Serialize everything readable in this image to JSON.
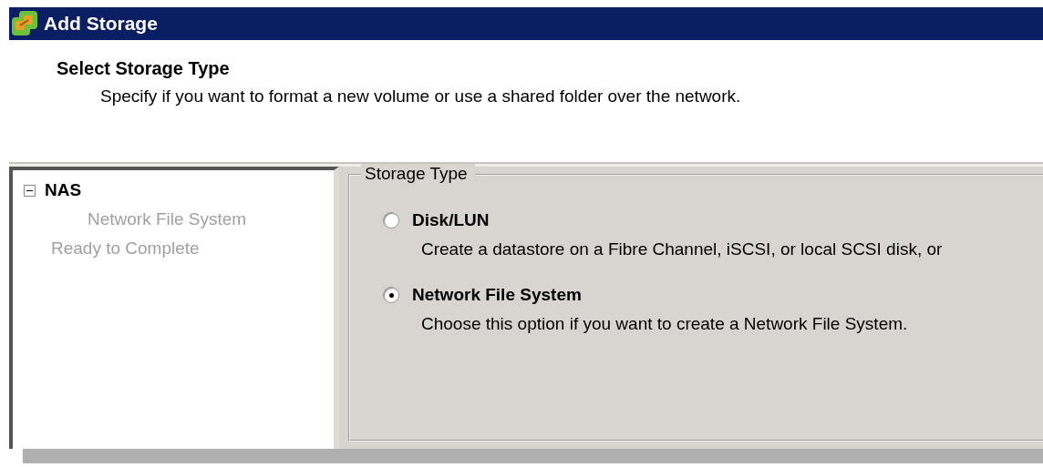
{
  "window": {
    "title": "Add Storage"
  },
  "header": {
    "title": "Select Storage Type",
    "subtitle": "Specify if you want to format a new volume or use a shared folder over the network."
  },
  "steps": [
    {
      "label": "NAS",
      "current": true,
      "expanded": true,
      "children": [
        {
          "label": "Network File System",
          "current": false
        }
      ]
    },
    {
      "label": "Ready to Complete",
      "current": false
    }
  ],
  "group": {
    "title": "Storage Type",
    "options": [
      {
        "label": "Disk/LUN",
        "description": "Create a datastore on a Fibre Channel, iSCSI, or local SCSI disk, or",
        "selected": false
      },
      {
        "label": "Network File System",
        "description": "Choose this option if you want to create a Network File System.",
        "selected": true
      }
    ]
  }
}
